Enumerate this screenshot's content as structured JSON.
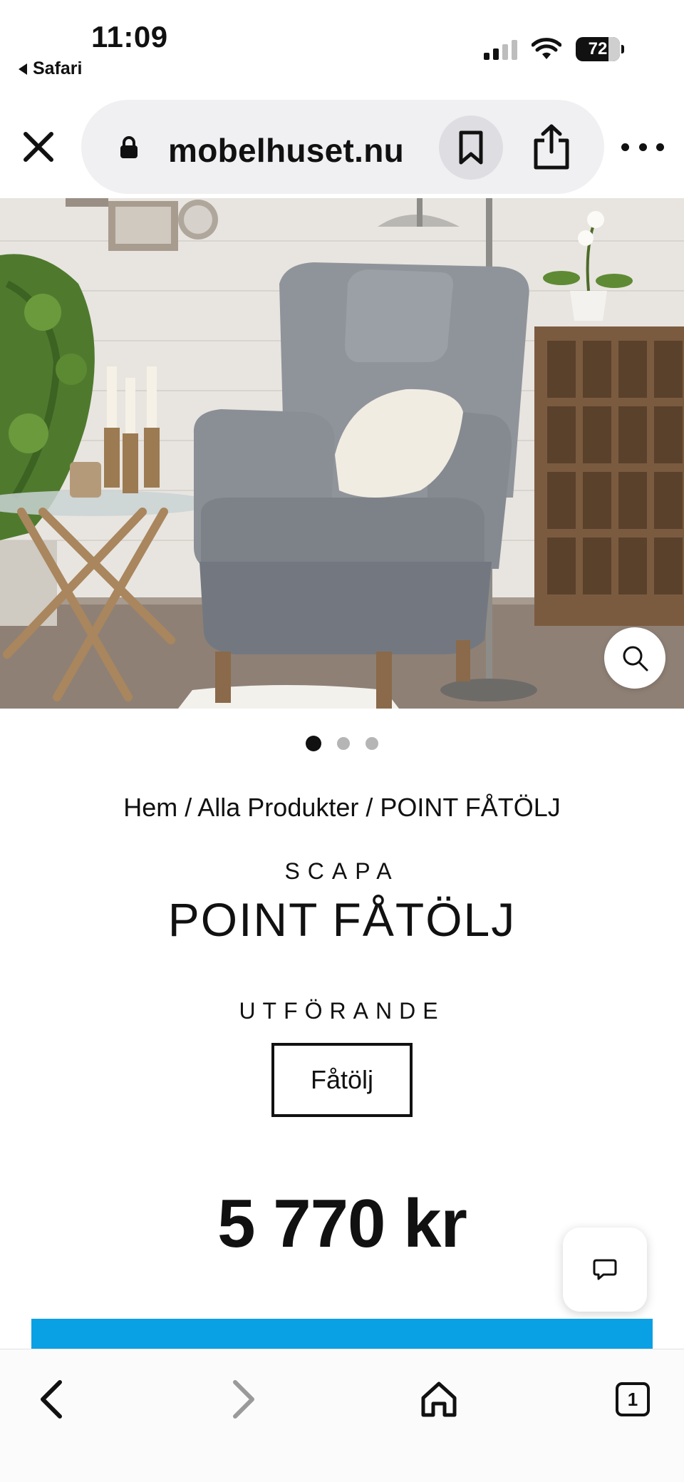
{
  "status_bar": {
    "time": "11:09",
    "back_app": "Safari",
    "battery": "72"
  },
  "browser": {
    "url": "mobelhuset.nu"
  },
  "icons": {
    "close": "close-icon",
    "lock": "lock-icon",
    "bookmark": "bookmark-icon",
    "share": "share-icon",
    "more": "more-icon",
    "zoom": "search-zoom-icon",
    "chat": "chat-icon",
    "back": "chevron-left-icon",
    "forward": "chevron-right-icon",
    "home": "home-icon",
    "tabs": "tabs-icon"
  },
  "carousel": {
    "count": 3,
    "active_index": 0
  },
  "breadcrumb": {
    "items": [
      "Hem",
      "Alla Produkter",
      "POINT FÅTÖLJ"
    ],
    "separator": " / "
  },
  "product": {
    "brand": "SCAPA",
    "title": "POINT FÅTÖLJ",
    "variant_label": "UTFÖRANDE",
    "variant_option": "Fåtölj",
    "price": "5 770 kr"
  },
  "toolbar": {
    "tabs_count": "1"
  },
  "colors": {
    "buy_button": "#0aa0e4",
    "text": "#111111",
    "url_pill": "#f0f0f2"
  }
}
